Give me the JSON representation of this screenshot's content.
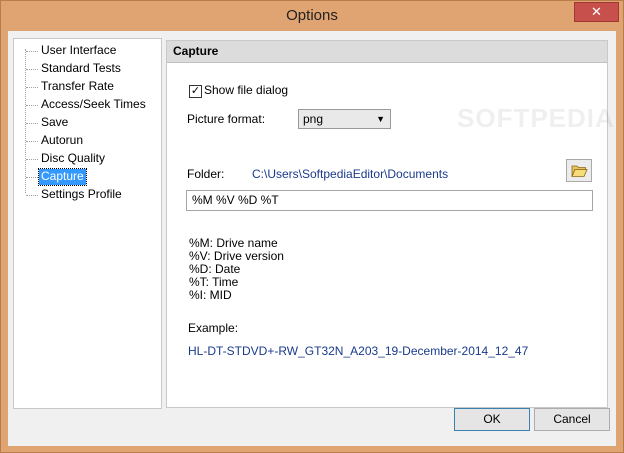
{
  "window": {
    "title": "Options",
    "close_label": "✕"
  },
  "tree": {
    "items": [
      {
        "label": "User Interface",
        "selected": false
      },
      {
        "label": "Standard Tests",
        "selected": false
      },
      {
        "label": "Transfer Rate",
        "selected": false
      },
      {
        "label": "Access/Seek Times",
        "selected": false
      },
      {
        "label": "Save",
        "selected": false
      },
      {
        "label": "Autorun",
        "selected": false
      },
      {
        "label": "Disc Quality",
        "selected": false
      },
      {
        "label": "Capture",
        "selected": true
      },
      {
        "label": "Settings Profile",
        "selected": false
      }
    ]
  },
  "panel": {
    "header": "Capture",
    "show_file_dialog": {
      "label": "Show file dialog",
      "checked": true
    },
    "picture_format": {
      "label": "Picture format:",
      "value": "png"
    },
    "folder": {
      "label": "Folder:",
      "path": "C:\\Users\\SoftpediaEditor\\Documents",
      "icon": "folder-open-icon"
    },
    "pattern": "%M %V %D %T",
    "legend": [
      "%M: Drive name",
      "%V: Drive version",
      "%D: Date",
      "%T: Time",
      "%I: MID"
    ],
    "example_label": "Example:",
    "example_value": "HL-DT-STDVD+-RW_GT32N_A203_19-December-2014_12_47"
  },
  "buttons": {
    "ok": "OK",
    "cancel": "Cancel"
  },
  "watermark": "SOFTPEDIA"
}
